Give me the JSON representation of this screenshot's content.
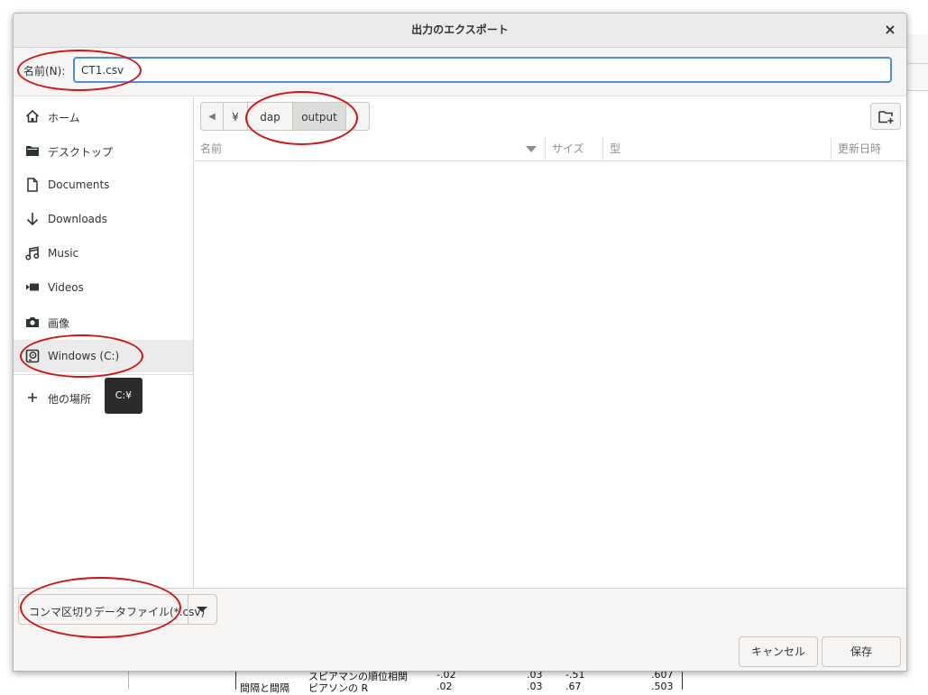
{
  "dialog": {
    "title": "出力のエクスポート",
    "close_glyph": "×"
  },
  "name_row": {
    "label": "名前(N):",
    "value": "CT1.csv"
  },
  "sidebar": {
    "items": [
      {
        "label": "ホーム",
        "icon": "home-icon"
      },
      {
        "label": "デスクトップ",
        "icon": "folder-icon"
      },
      {
        "label": "Documents",
        "icon": "document-icon"
      },
      {
        "label": "Downloads",
        "icon": "download-icon"
      },
      {
        "label": "Music",
        "icon": "music-icon"
      },
      {
        "label": "Videos",
        "icon": "video-icon"
      },
      {
        "label": "画像",
        "icon": "camera-icon"
      },
      {
        "label": "Windows (C:)",
        "icon": "drive-icon",
        "selected": true
      }
    ],
    "other_places": {
      "label": "他の場所",
      "icon": "plus-icon"
    },
    "tooltip": "C:¥"
  },
  "pathbar": {
    "back_glyph": "◀",
    "segments": [
      "¥",
      "dap",
      "output"
    ],
    "active": "output"
  },
  "columns": {
    "name": "名前",
    "size": "サイズ",
    "type": "型",
    "modified": "更新日時"
  },
  "filter": {
    "selected": "コンマ区切りデータファイル(*.csv)"
  },
  "buttons": {
    "cancel": "キャンセル",
    "save": "保存"
  },
  "background_table": {
    "row1": {
      "label": "スピアマンの順位相関",
      "v1": "-.02",
      "v2": ".03",
      "v3": "-.51",
      "v4": ".607"
    },
    "row2": {
      "label_a": "間隔と間隔",
      "label_b": "ピアソンの R",
      "v1": ".02",
      "v2": ".03",
      "v3": ".67",
      "v4": ".503"
    }
  },
  "accent_colors": {
    "focus_border": "#4a90d9",
    "annotation_ellipse": "#d11414"
  }
}
